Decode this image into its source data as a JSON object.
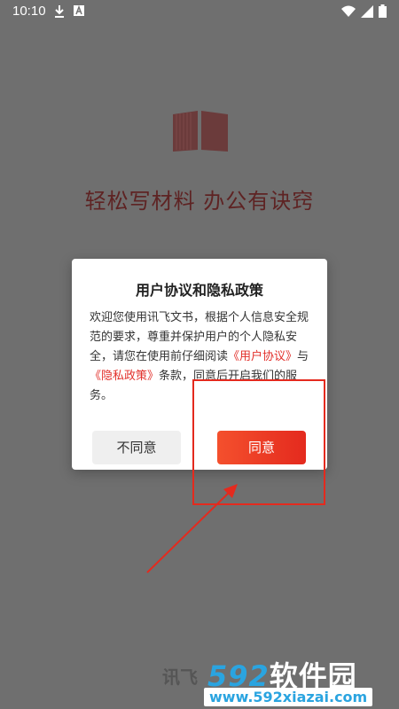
{
  "status_bar": {
    "time": "10:10",
    "left_icons": [
      "download-icon",
      "a-square-icon"
    ],
    "right_icons": [
      "wifi-icon",
      "signal-icon",
      "battery-icon"
    ]
  },
  "splash": {
    "slogan": "轻松写材料  办公有诀窍",
    "brand_partial": "讯飞"
  },
  "dialog": {
    "title": "用户协议和隐私政策",
    "body_prefix": "欢迎您使用讯飞文书，根据个人信息安全规范的要求，尊重并保护用户的个人隐私安全，请您在使用前仔细阅读",
    "link_user_agreement": "《用户协议》",
    "body_mid": "与",
    "link_privacy": "《隐私政策》",
    "body_suffix": "条款，同意后开启我们的服务。",
    "disagree_label": "不同意",
    "agree_label": "同意"
  },
  "watermark": {
    "number": "592",
    "text": "软件园",
    "url": "www.592xiazai.com"
  },
  "colors": {
    "overlay": "#6f6f6f",
    "accent": "#e42a1e",
    "slogan": "#5e2323",
    "watermark_blue": "#2aa4e0"
  }
}
